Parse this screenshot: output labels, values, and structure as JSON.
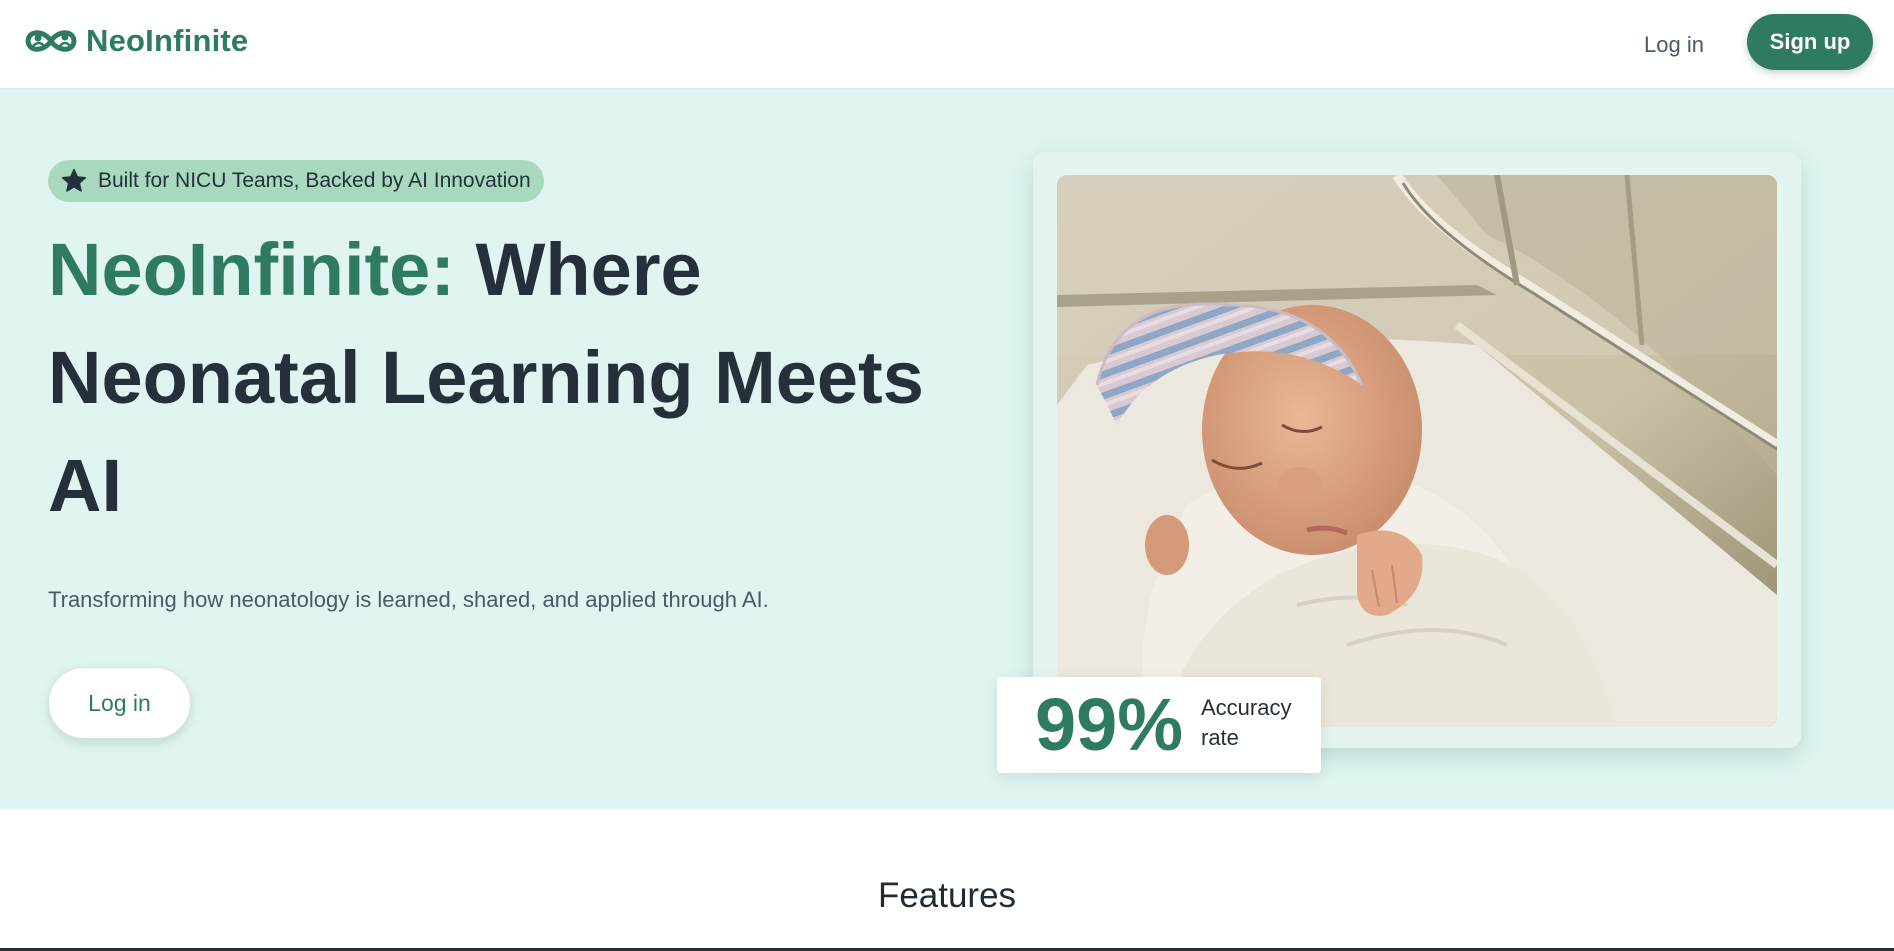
{
  "header": {
    "brand": "NeoInfinite",
    "login_label": "Log in",
    "signup_label": "Sign up"
  },
  "hero": {
    "badge_icon": "star-icon",
    "badge_text": "Built for NICU Teams, Backed by AI Innovation",
    "headline_accent": "NeoInfinite:",
    "headline_rest": "Where Neonatal Learning Meets AI",
    "subtitle": "Transforming how neonatology is learned, shared, and applied through AI.",
    "login_label": "Log in",
    "stat_value": "99%",
    "stat_label": "Accuracy rate"
  },
  "features": {
    "title": "Features"
  },
  "colors": {
    "brand": "#2f7b62",
    "hero_bg": "#e0f5f2",
    "badge_bg": "#a8d9bf",
    "text_dark": "#24303a"
  }
}
